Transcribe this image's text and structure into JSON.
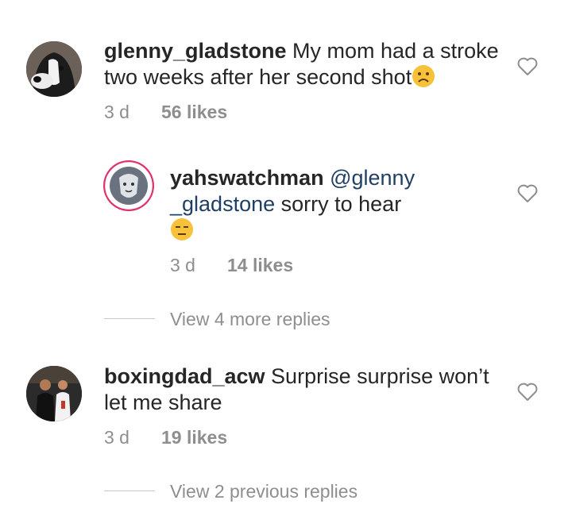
{
  "comments": [
    {
      "username": "glenny_gladstone",
      "text_line1": " My mom had a stroke",
      "text_line2": "two weeks after her second shot",
      "emoji": "frowning-face-emoji",
      "time": "3 d",
      "likes": "56 likes"
    },
    {
      "username": "yahswatchman",
      "mention_part1": "@glenny",
      "mention_part2": "_gladstone",
      "text": " sorry to hear",
      "emoji": "unamused-face-emoji",
      "time": "3 d",
      "likes": "14 likes"
    },
    {
      "username": "boxingdad_acw",
      "text_line1": " Surprise surprise won’t",
      "text_line2": "let me share",
      "time": "3 d",
      "likes": "19 likes"
    }
  ],
  "view_more_replies": "View 4 more replies",
  "view_previous_replies": "View 2 previous replies",
  "colors": {
    "text": "#262626",
    "muted": "#8e8e8e",
    "mention": "#1f3f66",
    "emoji_yellow": "#f7c23a"
  }
}
